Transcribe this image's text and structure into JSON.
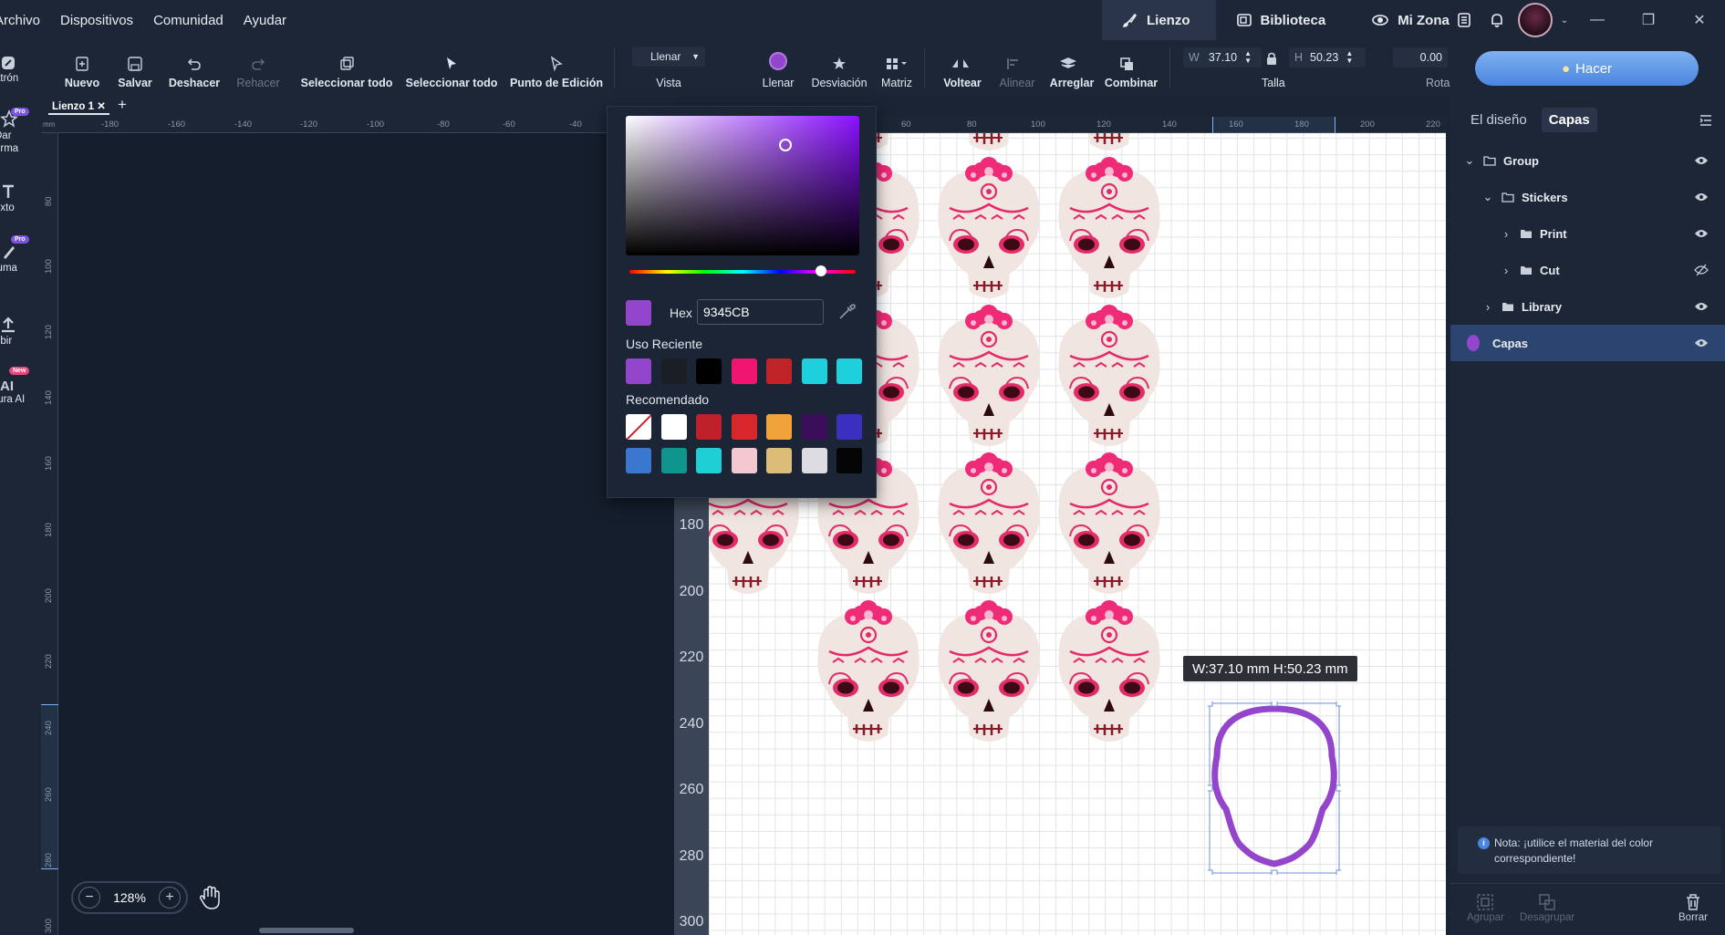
{
  "menu": [
    "Archivo",
    "Dispositivos",
    "Comunidad",
    "Ayudar"
  ],
  "tabs": [
    {
      "label": "Lienzo",
      "icon": "brush-icon",
      "active": true
    },
    {
      "label": "Biblioteca",
      "icon": "library-icon",
      "active": false
    },
    {
      "label": "Mi Zona",
      "icon": "globe-icon",
      "active": false
    }
  ],
  "toolbar": {
    "nuevo": "Nuevo",
    "salvar": "Salvar",
    "deshacer": "Deshacer",
    "rehacer": "Rehacer",
    "seleccionar_todo_1": "Seleccionar todo",
    "seleccionar_todo_2": "Seleccionar todo",
    "punto_edicion": "Punto de Edición",
    "vista_select": "Llenar",
    "vista": "Vista",
    "llenar": "Llenar",
    "desviacion": "Desviación",
    "matriz": "Matriz",
    "voltear": "Voltear",
    "alinear": "Alinear",
    "arreglar": "Arreglar",
    "combinar": "Combinar",
    "w_label": "W",
    "w_value": "37.10",
    "h_label": "H",
    "h_value": "50.23",
    "talla": "Talla",
    "rot_value": "0.00",
    "rota": "Rota"
  },
  "rail": [
    {
      "label": "atrón",
      "icon": "pattern-icon"
    },
    {
      "label": "Dar\norma",
      "icon": "shape-icon",
      "badge": "Pro"
    },
    {
      "label": "exto",
      "icon": "text-icon"
    },
    {
      "label": "luma",
      "icon": "pen-icon",
      "badge": "Pro"
    },
    {
      "label": "ubir",
      "icon": "upload-icon"
    },
    {
      "label": "tura AI",
      "icon": "ai-icon",
      "badge": "New"
    }
  ],
  "doc_tab": "Lienzo 1",
  "ruler_unit": "mm",
  "ruler_h": [
    "-180",
    "-160",
    "-140",
    "-120",
    "-100",
    "-80",
    "-60",
    "-40",
    "60",
    "80",
    "100",
    "120",
    "140",
    "160",
    "180",
    "200",
    "220"
  ],
  "ruler_v": [
    "80",
    "100",
    "120",
    "140",
    "160",
    "180",
    "200",
    "220",
    "240",
    "260",
    "280",
    "300"
  ],
  "canvas_side_numbers": [
    "180",
    "200",
    "220",
    "240",
    "260",
    "280",
    "300"
  ],
  "zoom": "128%",
  "dim_tooltip": "W:37.10 mm  H:50.23 mm",
  "picker": {
    "hex_label": "Hex",
    "hex_value": "9345CB",
    "current_color": "#9345CB",
    "recent_label": "Uso Reciente",
    "recent": [
      "#9345CB",
      "#1a1f26",
      "#000000",
      "#f0156e",
      "#c02428",
      "#1ed0dc",
      "#1ed0dc"
    ],
    "recommended_label": "Recomendado",
    "recommended": [
      "none",
      "#ffffff",
      "#c0202a",
      "#d8282e",
      "#f0a33a",
      "#3a0e5a",
      "#3b2fc0",
      "#3a78d0",
      "#10948e",
      "#1ed0d6",
      "#f3c8d0",
      "#dcbd78",
      "#dcdce2",
      "#050505"
    ]
  },
  "right_panel": {
    "hacer": "Hacer",
    "tab_diseno": "El diseño",
    "tab_capas": "Capas",
    "layers": [
      {
        "name": "Group",
        "chev": "v",
        "visible": true
      },
      {
        "name": "Stickers",
        "chev": "v",
        "visible": true
      },
      {
        "name": "Print",
        "chev": ">",
        "visible": true
      },
      {
        "name": "Cut",
        "chev": ">",
        "visible": false
      },
      {
        "name": "Library",
        "chev": ">",
        "visible": true
      },
      {
        "name": "Capas",
        "chev": "",
        "visible": true
      }
    ],
    "note": "Nota: ¡utilice el material del color correspondiente!",
    "agrupar": "Agrupar",
    "desagrupar": "Desagrupar",
    "borrar": "Borrar"
  },
  "colors": {
    "accent": "#4a86de",
    "selection": "#9345CB"
  }
}
